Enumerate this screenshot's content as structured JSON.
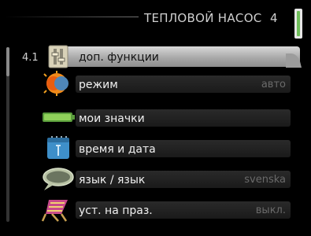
{
  "header": {
    "title": "ТЕПЛОВОЙ НАСОС",
    "menu_number": "4",
    "icon": "thermometer-gauge-icon"
  },
  "menu": {
    "selected_index": "4.1",
    "items": [
      {
        "label": "доп. функции",
        "value": "",
        "icon": "panel-settings-icon"
      },
      {
        "label": "режим",
        "value": "авто",
        "icon": "sun-globe-icon"
      },
      {
        "label": "мои значки",
        "value": "",
        "icon": "battery-bar-icon"
      },
      {
        "label": "время и дата",
        "value": "",
        "icon": "calendar-clock-icon"
      },
      {
        "label": "язык / язык",
        "value": "svenska",
        "icon": "speech-bubble-icon"
      },
      {
        "label": "уст. на праз.",
        "value": "выкл.",
        "icon": "beach-chair-icon"
      }
    ]
  },
  "colors": {
    "selected_bar": "#bdbdbd",
    "item_bar": "#222222",
    "value_text": "#6a6a6a"
  }
}
